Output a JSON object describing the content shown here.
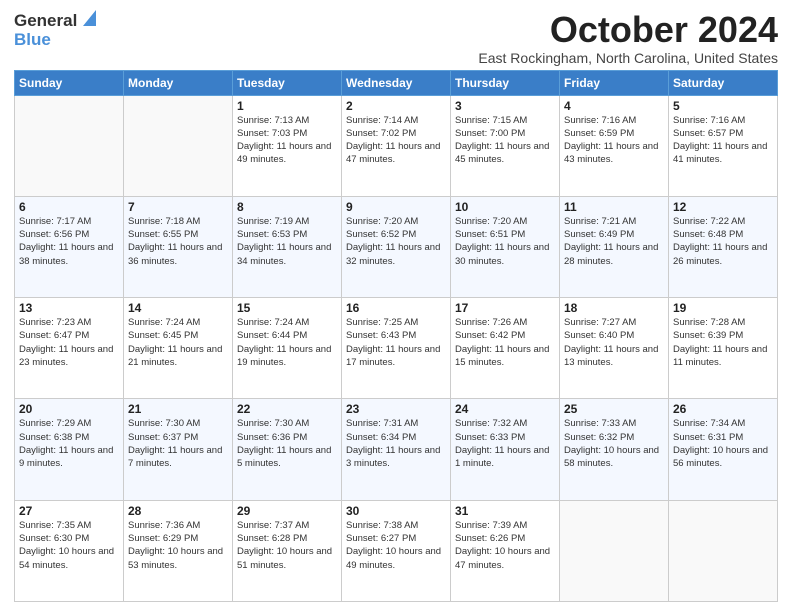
{
  "header": {
    "logo_general": "General",
    "logo_blue": "Blue",
    "month_title": "October 2024",
    "location": "East Rockingham, North Carolina, United States"
  },
  "days_of_week": [
    "Sunday",
    "Monday",
    "Tuesday",
    "Wednesday",
    "Thursday",
    "Friday",
    "Saturday"
  ],
  "weeks": [
    [
      {
        "day": "",
        "info": ""
      },
      {
        "day": "",
        "info": ""
      },
      {
        "day": "1",
        "info": "Sunrise: 7:13 AM\nSunset: 7:03 PM\nDaylight: 11 hours and 49 minutes."
      },
      {
        "day": "2",
        "info": "Sunrise: 7:14 AM\nSunset: 7:02 PM\nDaylight: 11 hours and 47 minutes."
      },
      {
        "day": "3",
        "info": "Sunrise: 7:15 AM\nSunset: 7:00 PM\nDaylight: 11 hours and 45 minutes."
      },
      {
        "day": "4",
        "info": "Sunrise: 7:16 AM\nSunset: 6:59 PM\nDaylight: 11 hours and 43 minutes."
      },
      {
        "day": "5",
        "info": "Sunrise: 7:16 AM\nSunset: 6:57 PM\nDaylight: 11 hours and 41 minutes."
      }
    ],
    [
      {
        "day": "6",
        "info": "Sunrise: 7:17 AM\nSunset: 6:56 PM\nDaylight: 11 hours and 38 minutes."
      },
      {
        "day": "7",
        "info": "Sunrise: 7:18 AM\nSunset: 6:55 PM\nDaylight: 11 hours and 36 minutes."
      },
      {
        "day": "8",
        "info": "Sunrise: 7:19 AM\nSunset: 6:53 PM\nDaylight: 11 hours and 34 minutes."
      },
      {
        "day": "9",
        "info": "Sunrise: 7:20 AM\nSunset: 6:52 PM\nDaylight: 11 hours and 32 minutes."
      },
      {
        "day": "10",
        "info": "Sunrise: 7:20 AM\nSunset: 6:51 PM\nDaylight: 11 hours and 30 minutes."
      },
      {
        "day": "11",
        "info": "Sunrise: 7:21 AM\nSunset: 6:49 PM\nDaylight: 11 hours and 28 minutes."
      },
      {
        "day": "12",
        "info": "Sunrise: 7:22 AM\nSunset: 6:48 PM\nDaylight: 11 hours and 26 minutes."
      }
    ],
    [
      {
        "day": "13",
        "info": "Sunrise: 7:23 AM\nSunset: 6:47 PM\nDaylight: 11 hours and 23 minutes."
      },
      {
        "day": "14",
        "info": "Sunrise: 7:24 AM\nSunset: 6:45 PM\nDaylight: 11 hours and 21 minutes."
      },
      {
        "day": "15",
        "info": "Sunrise: 7:24 AM\nSunset: 6:44 PM\nDaylight: 11 hours and 19 minutes."
      },
      {
        "day": "16",
        "info": "Sunrise: 7:25 AM\nSunset: 6:43 PM\nDaylight: 11 hours and 17 minutes."
      },
      {
        "day": "17",
        "info": "Sunrise: 7:26 AM\nSunset: 6:42 PM\nDaylight: 11 hours and 15 minutes."
      },
      {
        "day": "18",
        "info": "Sunrise: 7:27 AM\nSunset: 6:40 PM\nDaylight: 11 hours and 13 minutes."
      },
      {
        "day": "19",
        "info": "Sunrise: 7:28 AM\nSunset: 6:39 PM\nDaylight: 11 hours and 11 minutes."
      }
    ],
    [
      {
        "day": "20",
        "info": "Sunrise: 7:29 AM\nSunset: 6:38 PM\nDaylight: 11 hours and 9 minutes."
      },
      {
        "day": "21",
        "info": "Sunrise: 7:30 AM\nSunset: 6:37 PM\nDaylight: 11 hours and 7 minutes."
      },
      {
        "day": "22",
        "info": "Sunrise: 7:30 AM\nSunset: 6:36 PM\nDaylight: 11 hours and 5 minutes."
      },
      {
        "day": "23",
        "info": "Sunrise: 7:31 AM\nSunset: 6:34 PM\nDaylight: 11 hours and 3 minutes."
      },
      {
        "day": "24",
        "info": "Sunrise: 7:32 AM\nSunset: 6:33 PM\nDaylight: 11 hours and 1 minute."
      },
      {
        "day": "25",
        "info": "Sunrise: 7:33 AM\nSunset: 6:32 PM\nDaylight: 10 hours and 58 minutes."
      },
      {
        "day": "26",
        "info": "Sunrise: 7:34 AM\nSunset: 6:31 PM\nDaylight: 10 hours and 56 minutes."
      }
    ],
    [
      {
        "day": "27",
        "info": "Sunrise: 7:35 AM\nSunset: 6:30 PM\nDaylight: 10 hours and 54 minutes."
      },
      {
        "day": "28",
        "info": "Sunrise: 7:36 AM\nSunset: 6:29 PM\nDaylight: 10 hours and 53 minutes."
      },
      {
        "day": "29",
        "info": "Sunrise: 7:37 AM\nSunset: 6:28 PM\nDaylight: 10 hours and 51 minutes."
      },
      {
        "day": "30",
        "info": "Sunrise: 7:38 AM\nSunset: 6:27 PM\nDaylight: 10 hours and 49 minutes."
      },
      {
        "day": "31",
        "info": "Sunrise: 7:39 AM\nSunset: 6:26 PM\nDaylight: 10 hours and 47 minutes."
      },
      {
        "day": "",
        "info": ""
      },
      {
        "day": "",
        "info": ""
      }
    ]
  ]
}
